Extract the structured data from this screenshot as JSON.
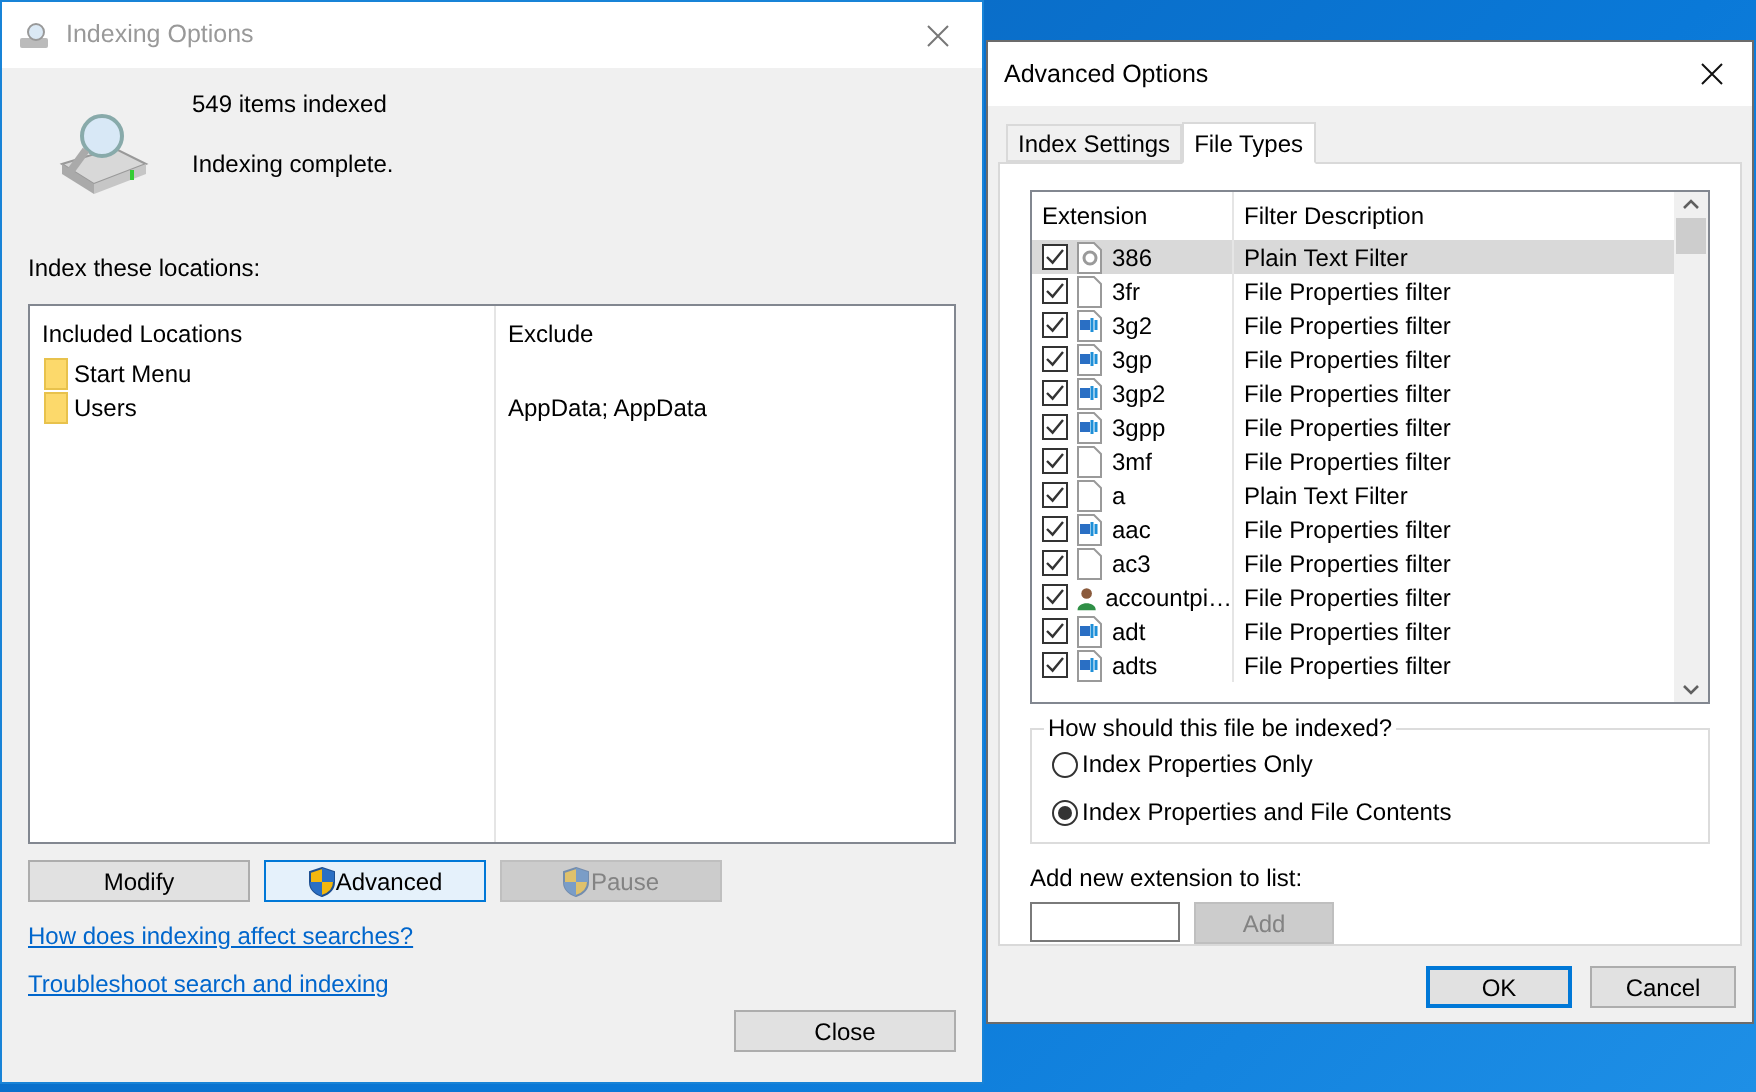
{
  "indexing_window": {
    "title": "Indexing Options",
    "items_indexed": "549 items indexed",
    "status": "Indexing complete.",
    "locations_label": "Index these locations:",
    "columns": [
      "Included Locations",
      "Exclude"
    ],
    "locations": [
      {
        "name": "Start Menu"
      },
      {
        "name": "Users",
        "exclude": "AppData; AppData"
      }
    ],
    "buttons": [
      {
        "label": "Modify",
        "shield": false,
        "focused": false,
        "disabled": false
      },
      {
        "label": "Advanced",
        "shield": true,
        "focused": true,
        "disabled": false
      },
      {
        "label": "Pause",
        "shield": true,
        "focused": false,
        "disabled": true
      }
    ],
    "links": [
      "How does indexing affect searches?",
      "Troubleshoot search and indexing"
    ],
    "close_button": "Close"
  },
  "advanced_window": {
    "title": "Advanced Options",
    "tabs": [
      {
        "label": "Index Settings",
        "selected": false
      },
      {
        "label": "File Types",
        "selected": true
      }
    ],
    "columns": [
      "Extension",
      "Filter Description"
    ],
    "file_types": [
      {
        "extension": "386",
        "filter": "Plain Text Filter",
        "kind": "text",
        "checked": true,
        "selected": true
      },
      {
        "extension": "3fr",
        "filter": "File Properties filter",
        "kind": "blank",
        "checked": true,
        "selected": false
      },
      {
        "extension": "3g2",
        "filter": "File Properties filter",
        "kind": "media",
        "checked": true,
        "selected": false
      },
      {
        "extension": "3gp",
        "filter": "File Properties filter",
        "kind": "media",
        "checked": true,
        "selected": false
      },
      {
        "extension": "3gp2",
        "filter": "File Properties filter",
        "kind": "media",
        "checked": true,
        "selected": false
      },
      {
        "extension": "3gpp",
        "filter": "File Properties filter",
        "kind": "media",
        "checked": true,
        "selected": false
      },
      {
        "extension": "3mf",
        "filter": "File Properties filter",
        "kind": "blank",
        "checked": true,
        "selected": false
      },
      {
        "extension": "a",
        "filter": "Plain Text Filter",
        "kind": "blank",
        "checked": true,
        "selected": false
      },
      {
        "extension": "aac",
        "filter": "File Properties filter",
        "kind": "media",
        "checked": true,
        "selected": false
      },
      {
        "extension": "ac3",
        "filter": "File Properties filter",
        "kind": "blank",
        "checked": true,
        "selected": false
      },
      {
        "extension": "accountpi…",
        "filter": "File Properties filter",
        "kind": "user",
        "checked": true,
        "selected": false
      },
      {
        "extension": "adt",
        "filter": "File Properties filter",
        "kind": "media",
        "checked": true,
        "selected": false
      },
      {
        "extension": "adts",
        "filter": "File Properties filter",
        "kind": "media",
        "checked": true,
        "selected": false
      }
    ],
    "group_label": "How should this file be indexed?",
    "options": [
      {
        "label": "Index Properties Only",
        "selected": false
      },
      {
        "label": "Index Properties and File Contents",
        "selected": true
      }
    ],
    "add_label": "Add new extension to list:",
    "add_button": {
      "label": "Add",
      "disabled": true
    },
    "ok_button": "OK",
    "cancel_button": "Cancel"
  }
}
